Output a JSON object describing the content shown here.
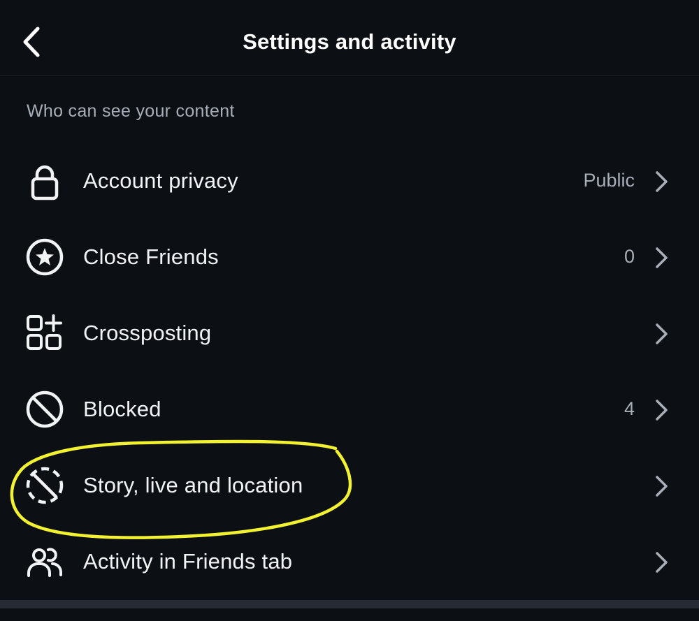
{
  "header": {
    "title": "Settings and activity",
    "back_icon": "chevron-left-icon"
  },
  "section": {
    "title": "Who can see your content"
  },
  "items": [
    {
      "label": "Account privacy",
      "value": "Public",
      "icon": "lock-icon"
    },
    {
      "label": "Close Friends",
      "value": "0",
      "icon": "star-circle-icon"
    },
    {
      "label": "Crossposting",
      "value": "",
      "icon": "crossposting-icon"
    },
    {
      "label": "Blocked",
      "value": "4",
      "icon": "blocked-icon"
    },
    {
      "label": "Story, live and location",
      "value": "",
      "icon": "story-hidden-icon"
    },
    {
      "label": "Activity in Friends tab",
      "value": "",
      "icon": "friends-icon"
    }
  ],
  "annotation": {
    "highlight_color": "#f2f230"
  }
}
